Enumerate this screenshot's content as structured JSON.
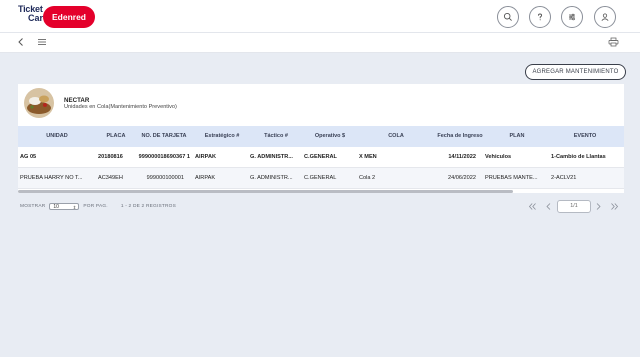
{
  "brand": {
    "line1": "Ticket",
    "line2": "Car",
    "badge": "Edenred",
    "brand_color": "#e4002b",
    "text_color": "#1f2a5a"
  },
  "header_icons": [
    "search-icon",
    "help-icon",
    "filter-icon",
    "user-icon"
  ],
  "toolbar": {
    "back_icon": "chevron-left-icon",
    "menu_icon": "hamburger-menu-icon",
    "print_icon": "printer-icon"
  },
  "add_button": {
    "label": "AGREGAR MANTENIMIENTO"
  },
  "card": {
    "name": "NECTAR",
    "description": "Unidades en Cola(Mantenimiento Preventivo)"
  },
  "table": {
    "columns": [
      "UNIDAD",
      "PLACA",
      "NO. DE TARJETA",
      "Estratégico #",
      "Táctico #",
      "Operativo $",
      "COLA",
      "Fecha de Ingreso",
      "PLAN",
      "EVENTO"
    ],
    "rows": [
      [
        "AG 05",
        "20180816",
        "999000018690367 1",
        "AIRPAK",
        "G. ADMINISTR...",
        "C.GENERAL",
        "X MEN",
        "14/11/2022",
        "Vehiculos",
        "1-Cambio de Llantas"
      ],
      [
        "PRUEBA HARRY NO T...",
        "AC349EH",
        "999000100001",
        "AIRPAK",
        "G. ADMINISTR...",
        "C.GENERAL",
        "Cola 2",
        "24/06/2022",
        "PRUEBAS MANTE...",
        "2-ACLV21"
      ]
    ]
  },
  "pagination": {
    "show_label": "MOSTRAR",
    "page_size": "10",
    "per_page_label": "POR PAG.",
    "records_text": "1 - 2 DE 2 REGISTROS",
    "page_text": "1/1"
  }
}
